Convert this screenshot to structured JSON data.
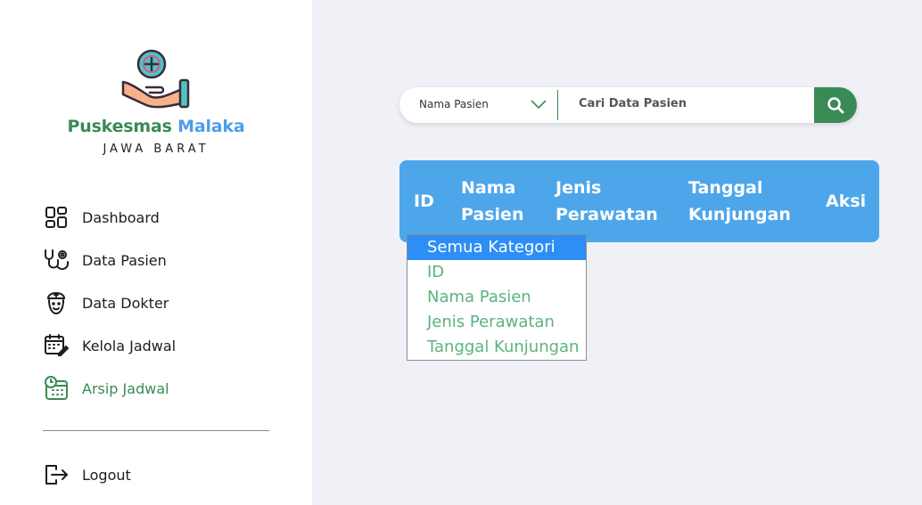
{
  "brand": {
    "name_part1": "Puskesmas",
    "name_part2": "Malaka",
    "region": "JAWA BARAT"
  },
  "sidebar": {
    "items": [
      {
        "label": "Dashboard",
        "icon": "dashboard-icon",
        "active": false
      },
      {
        "label": "Data Pasien",
        "icon": "stethoscope-icon",
        "active": false
      },
      {
        "label": "Data Dokter",
        "icon": "doctor-icon",
        "active": false
      },
      {
        "label": "Kelola Jadwal",
        "icon": "calendar-edit-icon",
        "active": false
      },
      {
        "label": "Arsip Jadwal",
        "icon": "calendar-clock-icon",
        "active": true
      }
    ],
    "logout": {
      "label": "Logout",
      "icon": "logout-icon"
    }
  },
  "search": {
    "category_selected": "Nama Pasien",
    "placeholder": "Cari Data Pasien",
    "icon": "search-icon"
  },
  "table": {
    "headers": [
      {
        "line1": "ID",
        "line2": ""
      },
      {
        "line1": "Nama",
        "line2": "Pasien"
      },
      {
        "line1": "Jenis",
        "line2": "Perawatan"
      },
      {
        "line1": "Tanggal",
        "line2": "Kunjungan"
      },
      {
        "line1": "Aksi",
        "line2": ""
      }
    ]
  },
  "dropdown": {
    "options": [
      "Semua Kategori",
      "ID",
      "Nama Pasien",
      "Jenis Perawatan",
      "Tanggal Kunjungan"
    ],
    "highlighted": "Semua Kategori"
  },
  "colors": {
    "primary_green": "#3a8a55",
    "primary_blue": "#4ea6ea",
    "highlight_blue": "#2d8ef5",
    "option_green": "#5cb37e"
  }
}
